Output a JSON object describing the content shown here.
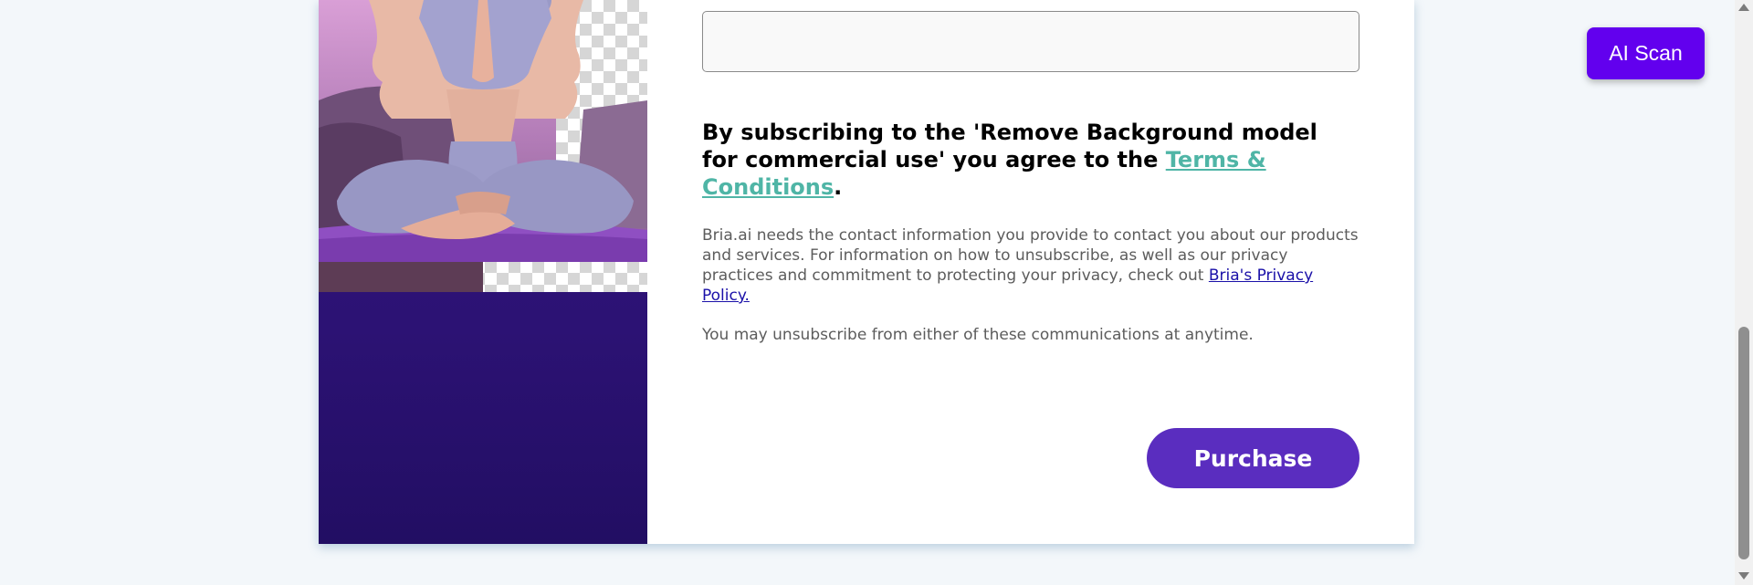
{
  "consent": {
    "agree_prefix": "By subscribing to the 'Remove Background model for commercial use' you agree to the ",
    "terms_link": "Terms & Conditions",
    "agree_suffix": ".",
    "info_text": "Bria.ai needs the contact information you provide to contact you about our products and services. For information on how to unsubscribe, as well as our privacy practices and commitment to protecting your privacy, check out ",
    "privacy_link": "Bria's Privacy Policy.",
    "unsubscribe_text": "You may unsubscribe from either of these communications at anytime."
  },
  "actions": {
    "purchase_label": "Purchase",
    "ai_scan_label": "AI Scan"
  },
  "colors": {
    "accent_purple": "#5a2dbf",
    "ai_scan_purple": "#6200ee",
    "terms_link_teal": "#4fb5a6",
    "side_panel": "#2c1274"
  },
  "icons": {
    "scroll_up": "triangle-up-icon",
    "scroll_down": "triangle-down-icon"
  }
}
